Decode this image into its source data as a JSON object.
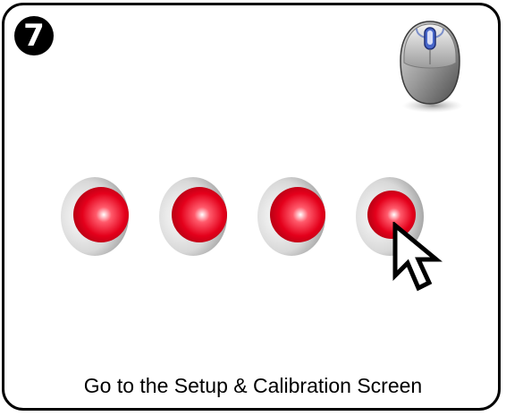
{
  "step": {
    "number": "7"
  },
  "indicators": {
    "count": 4,
    "color": "#e4001b",
    "items": [
      {
        "name": "indicator-1"
      },
      {
        "name": "indicator-2"
      },
      {
        "name": "indicator-3"
      },
      {
        "name": "indicator-4"
      }
    ]
  },
  "icons": {
    "device": "mouse-icon",
    "pointer": "cursor-arrow-icon"
  },
  "instruction": {
    "text": "Go to the Setup & Calibration Screen"
  }
}
